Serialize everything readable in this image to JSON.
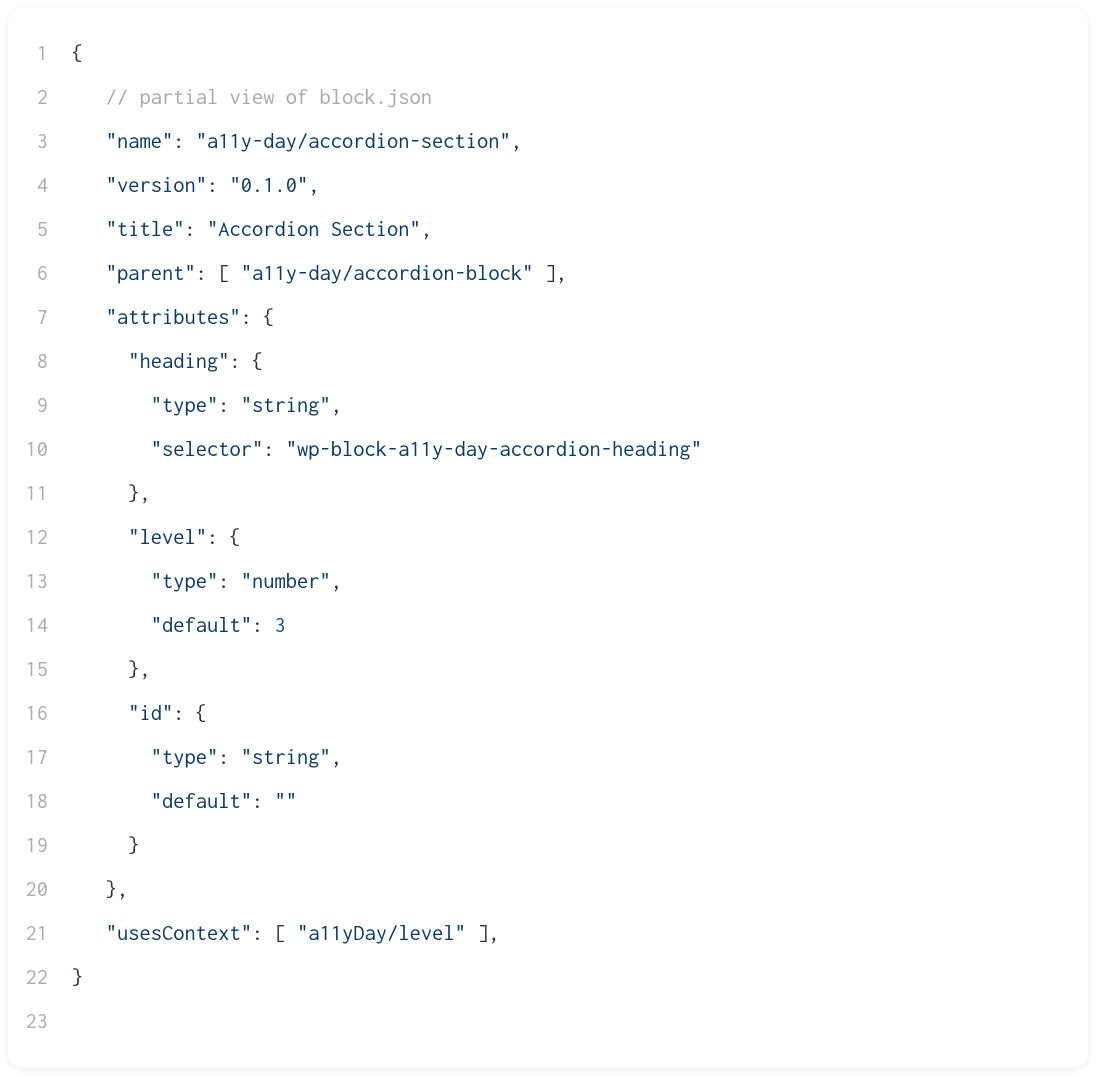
{
  "lines": [
    {
      "num": "1",
      "tokens": [
        {
          "cls": "tok-punct",
          "text": "{"
        }
      ]
    },
    {
      "num": "2",
      "tokens": [
        {
          "cls": "indent",
          "text": "   "
        },
        {
          "cls": "tok-comment",
          "text": "// partial view of block.json"
        }
      ]
    },
    {
      "num": "3",
      "tokens": [
        {
          "cls": "indent",
          "text": "   "
        },
        {
          "cls": "tok-property",
          "text": "\"name\""
        },
        {
          "cls": "tok-punct",
          "text": ": "
        },
        {
          "cls": "tok-string",
          "text": "\"a11y-day/accordion-section\""
        },
        {
          "cls": "tok-punct",
          "text": ","
        }
      ]
    },
    {
      "num": "4",
      "tokens": [
        {
          "cls": "indent",
          "text": "   "
        },
        {
          "cls": "tok-property",
          "text": "\"version\""
        },
        {
          "cls": "tok-punct",
          "text": ": "
        },
        {
          "cls": "tok-string",
          "text": "\"0.1.0\""
        },
        {
          "cls": "tok-punct",
          "text": ","
        }
      ]
    },
    {
      "num": "5",
      "tokens": [
        {
          "cls": "indent",
          "text": "   "
        },
        {
          "cls": "tok-property",
          "text": "\"title\""
        },
        {
          "cls": "tok-punct",
          "text": ": "
        },
        {
          "cls": "tok-string",
          "text": "\"Accordion Section\""
        },
        {
          "cls": "tok-punct",
          "text": ","
        }
      ]
    },
    {
      "num": "6",
      "tokens": [
        {
          "cls": "indent",
          "text": "   "
        },
        {
          "cls": "tok-property",
          "text": "\"parent\""
        },
        {
          "cls": "tok-punct",
          "text": ": "
        },
        {
          "cls": "tok-bracket",
          "text": "[ "
        },
        {
          "cls": "tok-string",
          "text": "\"a11y-day/accordion-block\""
        },
        {
          "cls": "tok-bracket",
          "text": " ]"
        },
        {
          "cls": "tok-punct",
          "text": ","
        }
      ]
    },
    {
      "num": "7",
      "tokens": [
        {
          "cls": "indent",
          "text": "   "
        },
        {
          "cls": "tok-property",
          "text": "\"attributes\""
        },
        {
          "cls": "tok-punct",
          "text": ": {"
        }
      ]
    },
    {
      "num": "8",
      "tokens": [
        {
          "cls": "indent",
          "text": "     "
        },
        {
          "cls": "tok-property",
          "text": "\"heading\""
        },
        {
          "cls": "tok-punct",
          "text": ": {"
        }
      ]
    },
    {
      "num": "9",
      "tokens": [
        {
          "cls": "indent",
          "text": "       "
        },
        {
          "cls": "tok-property",
          "text": "\"type\""
        },
        {
          "cls": "tok-punct",
          "text": ": "
        },
        {
          "cls": "tok-string",
          "text": "\"string\""
        },
        {
          "cls": "tok-punct",
          "text": ","
        }
      ]
    },
    {
      "num": "10",
      "tokens": [
        {
          "cls": "indent",
          "text": "       "
        },
        {
          "cls": "tok-property",
          "text": "\"selector\""
        },
        {
          "cls": "tok-punct",
          "text": ": "
        },
        {
          "cls": "tok-string",
          "text": "\"wp-block-a11y-day-accordion-heading\""
        }
      ]
    },
    {
      "num": "11",
      "tokens": [
        {
          "cls": "indent",
          "text": "     "
        },
        {
          "cls": "tok-punct",
          "text": "},"
        }
      ]
    },
    {
      "num": "12",
      "tokens": [
        {
          "cls": "indent",
          "text": "     "
        },
        {
          "cls": "tok-property",
          "text": "\"level\""
        },
        {
          "cls": "tok-punct",
          "text": ": {"
        }
      ]
    },
    {
      "num": "13",
      "tokens": [
        {
          "cls": "indent",
          "text": "       "
        },
        {
          "cls": "tok-property",
          "text": "\"type\""
        },
        {
          "cls": "tok-punct",
          "text": ": "
        },
        {
          "cls": "tok-string",
          "text": "\"number\""
        },
        {
          "cls": "tok-punct",
          "text": ","
        }
      ]
    },
    {
      "num": "14",
      "tokens": [
        {
          "cls": "indent",
          "text": "       "
        },
        {
          "cls": "tok-property",
          "text": "\"default\""
        },
        {
          "cls": "tok-punct",
          "text": ": "
        },
        {
          "cls": "tok-number",
          "text": "3"
        }
      ]
    },
    {
      "num": "15",
      "tokens": [
        {
          "cls": "indent",
          "text": "     "
        },
        {
          "cls": "tok-punct",
          "text": "},"
        }
      ]
    },
    {
      "num": "16",
      "tokens": [
        {
          "cls": "indent",
          "text": "     "
        },
        {
          "cls": "tok-property",
          "text": "\"id\""
        },
        {
          "cls": "tok-punct",
          "text": ": {"
        }
      ]
    },
    {
      "num": "17",
      "tokens": [
        {
          "cls": "indent",
          "text": "       "
        },
        {
          "cls": "tok-property",
          "text": "\"type\""
        },
        {
          "cls": "tok-punct",
          "text": ": "
        },
        {
          "cls": "tok-string",
          "text": "\"string\""
        },
        {
          "cls": "tok-punct",
          "text": ","
        }
      ]
    },
    {
      "num": "18",
      "tokens": [
        {
          "cls": "indent",
          "text": "       "
        },
        {
          "cls": "tok-property",
          "text": "\"default\""
        },
        {
          "cls": "tok-punct",
          "text": ": "
        },
        {
          "cls": "tok-empty-string",
          "text": "\"\""
        }
      ]
    },
    {
      "num": "19",
      "tokens": [
        {
          "cls": "indent",
          "text": "     "
        },
        {
          "cls": "tok-punct",
          "text": "}"
        }
      ]
    },
    {
      "num": "20",
      "tokens": [
        {
          "cls": "indent",
          "text": "   "
        },
        {
          "cls": "tok-punct",
          "text": "},"
        }
      ]
    },
    {
      "num": "21",
      "tokens": [
        {
          "cls": "indent",
          "text": "   "
        },
        {
          "cls": "tok-property",
          "text": "\"usesContext\""
        },
        {
          "cls": "tok-punct",
          "text": ": "
        },
        {
          "cls": "tok-bracket",
          "text": "[ "
        },
        {
          "cls": "tok-string",
          "text": "\"a11yDay/level\""
        },
        {
          "cls": "tok-bracket",
          "text": " ]"
        },
        {
          "cls": "tok-punct",
          "text": ","
        }
      ]
    },
    {
      "num": "22",
      "tokens": [
        {
          "cls": "tok-punct",
          "text": "}"
        }
      ]
    },
    {
      "num": "23",
      "tokens": []
    }
  ]
}
